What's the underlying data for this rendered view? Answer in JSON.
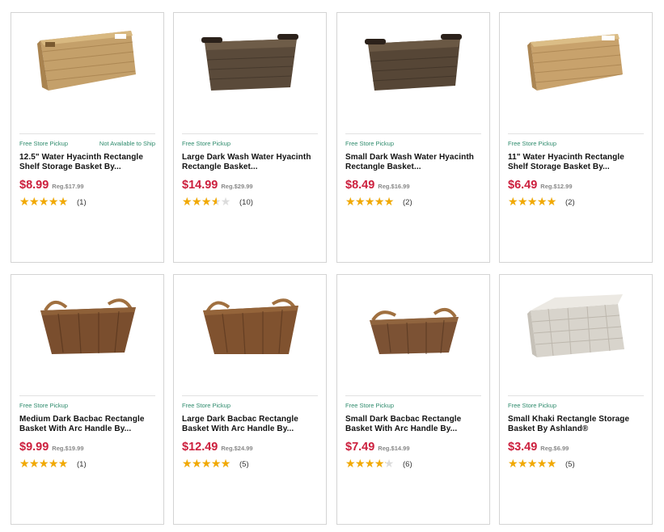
{
  "products": [
    {
      "pickup": "Free Store Pickup",
      "ship": "Not Available to Ship",
      "title": "12.5\" Water Hyacinth Rectangle Shelf Storage Basket By...",
      "price": "$8.99",
      "reg": "Reg.$17.99",
      "rating": 5,
      "count": "(1)",
      "image": "light-hyacinth-basket",
      "color": "#c4a06a"
    },
    {
      "pickup": "Free Store Pickup",
      "ship": "",
      "title": "Large Dark Wash Water Hyacinth Rectangle Basket...",
      "price": "$14.99",
      "reg": "Reg.$29.99",
      "rating": 3.5,
      "count": "(10)",
      "image": "dark-wash-basket",
      "color": "#5a4a3a"
    },
    {
      "pickup": "Free Store Pickup",
      "ship": "",
      "title": "Small Dark Wash Water Hyacinth Rectangle Basket...",
      "price": "$8.49",
      "reg": "Reg.$16.99",
      "rating": 5,
      "count": "(2)",
      "image": "dark-wash-basket",
      "color": "#5a4a3a"
    },
    {
      "pickup": "Free Store Pickup",
      "ship": "",
      "title": "11\" Water Hyacinth Rectangle Shelf Storage Basket By...",
      "price": "$6.49",
      "reg": "Reg.$12.99",
      "rating": 5,
      "count": "(2)",
      "image": "light-hyacinth-basket",
      "color": "#c8a26c"
    },
    {
      "pickup": "Free Store Pickup",
      "ship": "",
      "title": "Medium Dark Bacbac Rectangle Basket With Arc Handle By...",
      "price": "$9.99",
      "reg": "Reg.$19.99",
      "rating": 5,
      "count": "(1)",
      "image": "bacbac-handle-basket",
      "color": "#7a4e2e"
    },
    {
      "pickup": "Free Store Pickup",
      "ship": "",
      "title": "Large Dark Bacbac Rectangle Basket With Arc Handle By...",
      "price": "$12.49",
      "reg": "Reg.$24.99",
      "rating": 5,
      "count": "(5)",
      "image": "bacbac-handle-basket",
      "color": "#80522f"
    },
    {
      "pickup": "Free Store Pickup",
      "ship": "",
      "title": "Small Dark Bacbac Rectangle Basket With Arc Handle By...",
      "price": "$7.49",
      "reg": "Reg.$14.99",
      "rating": 4,
      "count": "(6)",
      "image": "bacbac-handle-basket",
      "color": "#7c5234"
    },
    {
      "pickup": "Free Store Pickup",
      "ship": "",
      "title": "Small Khaki Rectangle Storage Basket By Ashland®",
      "price": "$3.49",
      "reg": "Reg.$6.99",
      "rating": 5,
      "count": "(5)",
      "image": "khaki-fabric-basket",
      "color": "#d8d4cc"
    }
  ]
}
